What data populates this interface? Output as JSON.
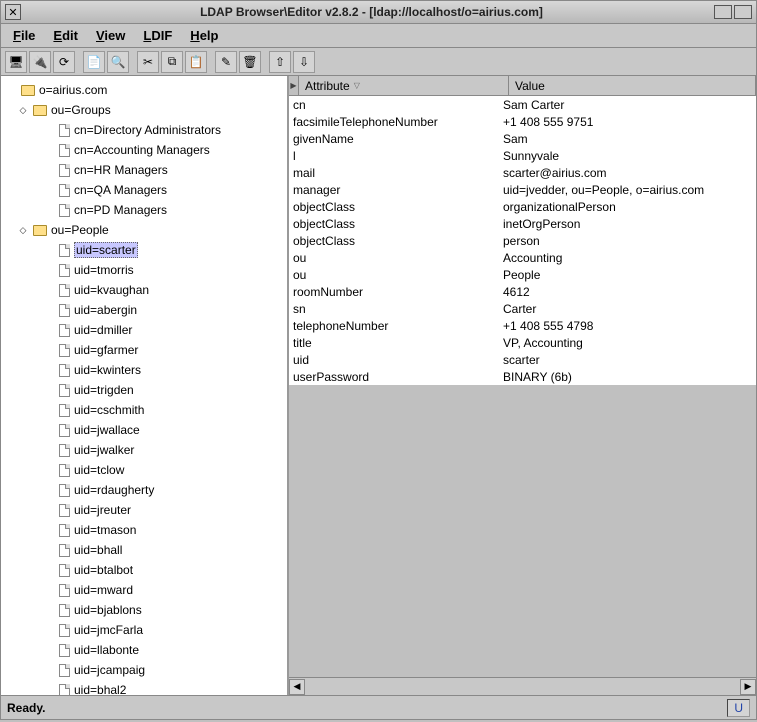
{
  "window": {
    "title": "LDAP Browser\\Editor v2.8.2 - [ldap://localhost/o=airius.com]"
  },
  "menubar": [
    "File",
    "Edit",
    "View",
    "LDIF",
    "Help"
  ],
  "statusbar": {
    "text": "Ready.",
    "indicator": "U"
  },
  "attr_header": {
    "col1": "Attribute",
    "col2": "Value"
  },
  "tree": {
    "root": "o=airius.com",
    "groups_label": "ou=Groups",
    "groups": [
      "cn=Directory Administrators",
      "cn=Accounting Managers",
      "cn=HR Managers",
      "cn=QA Managers",
      "cn=PD Managers"
    ],
    "people_label": "ou=People",
    "selected": "uid=scarter",
    "people": [
      "uid=scarter",
      "uid=tmorris",
      "uid=kvaughan",
      "uid=abergin",
      "uid=dmiller",
      "uid=gfarmer",
      "uid=kwinters",
      "uid=trigden",
      "uid=cschmith",
      "uid=jwallace",
      "uid=jwalker",
      "uid=tclow",
      "uid=rdaugherty",
      "uid=jreuter",
      "uid=tmason",
      "uid=bhall",
      "uid=btalbot",
      "uid=mward",
      "uid=bjablons",
      "uid=jmcFarla",
      "uid=llabonte",
      "uid=jcampaig",
      "uid=bhal2"
    ]
  },
  "attributes": [
    {
      "a": "cn",
      "v": "Sam Carter"
    },
    {
      "a": "facsimileTelephoneNumber",
      "v": "+1 408 555 9751"
    },
    {
      "a": "givenName",
      "v": "Sam"
    },
    {
      "a": "l",
      "v": "Sunnyvale"
    },
    {
      "a": "mail",
      "v": "scarter@airius.com"
    },
    {
      "a": "manager",
      "v": "uid=jvedder, ou=People, o=airius.com"
    },
    {
      "a": "objectClass",
      "v": "organizationalPerson"
    },
    {
      "a": "objectClass",
      "v": "inetOrgPerson"
    },
    {
      "a": "objectClass",
      "v": "person"
    },
    {
      "a": "ou",
      "v": "Accounting"
    },
    {
      "a": "ou",
      "v": "People"
    },
    {
      "a": "roomNumber",
      "v": "4612"
    },
    {
      "a": "sn",
      "v": "Carter"
    },
    {
      "a": "telephoneNumber",
      "v": "+1 408 555 4798"
    },
    {
      "a": "title",
      "v": "VP, Accounting"
    },
    {
      "a": "uid",
      "v": "scarter"
    },
    {
      "a": "userPassword",
      "v": "BINARY (6b)"
    }
  ]
}
